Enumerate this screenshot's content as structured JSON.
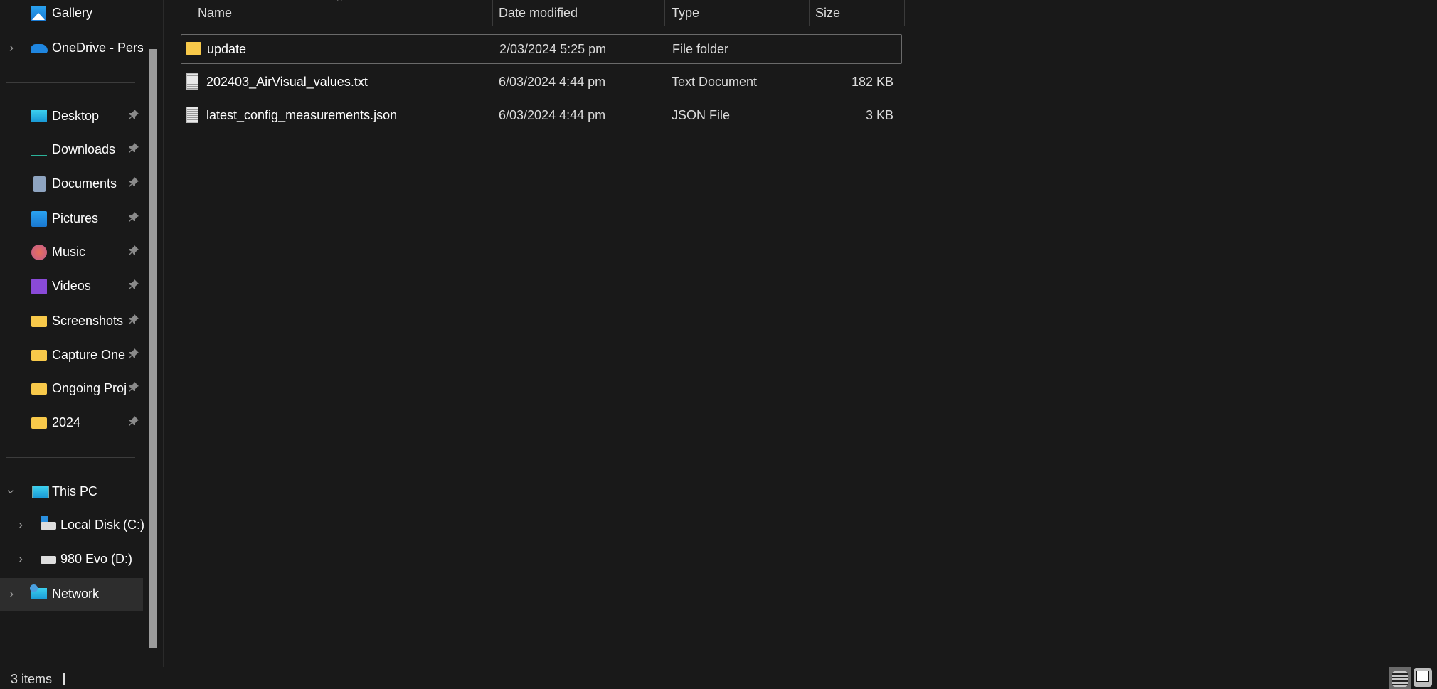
{
  "sidebar": {
    "top_items": [
      {
        "label": "Gallery",
        "icon": "gallery-icon",
        "expandable": false
      },
      {
        "label": "OneDrive - Personal",
        "icon": "onedrive-cloud-icon",
        "expandable": true
      }
    ],
    "quick_access": [
      {
        "label": "Desktop",
        "icon": "desktop-icon",
        "pinned": true
      },
      {
        "label": "Downloads",
        "icon": "download-icon",
        "pinned": true
      },
      {
        "label": "Documents",
        "icon": "documents-icon",
        "pinned": true
      },
      {
        "label": "Pictures",
        "icon": "pictures-icon",
        "pinned": true
      },
      {
        "label": "Music",
        "icon": "music-icon",
        "pinned": true
      },
      {
        "label": "Videos",
        "icon": "videos-icon",
        "pinned": true
      },
      {
        "label": "Screenshots",
        "icon": "folder-icon",
        "pinned": true
      },
      {
        "label": "Capture One",
        "icon": "folder-icon",
        "pinned": true
      },
      {
        "label": "Ongoing Projects",
        "icon": "folder-icon",
        "pinned": true
      },
      {
        "label": "2024",
        "icon": "folder-icon",
        "pinned": true
      }
    ],
    "this_pc": {
      "label": "This PC",
      "icon": "monitor-icon",
      "expanded": true
    },
    "drives": [
      {
        "label": "Local Disk (C:)",
        "icon": "drive-c-icon"
      },
      {
        "label": "980 Evo (D:)",
        "icon": "drive-d-icon"
      }
    ],
    "network": {
      "label": "Network",
      "icon": "network-icon",
      "selected": true
    }
  },
  "file_list": {
    "columns": {
      "name": "Name",
      "date": "Date modified",
      "type": "Type",
      "size": "Size"
    },
    "sort_column": "Name",
    "rows": [
      {
        "name": "update",
        "date": "2/03/2024 5:25 pm",
        "type": "File folder",
        "size": "",
        "icon": "folder-icon",
        "focused": true
      },
      {
        "name": "202403_AirVisual_values.txt",
        "date": "6/03/2024 4:44 pm",
        "type": "Text Document",
        "size": "182 KB",
        "icon": "text-file-icon"
      },
      {
        "name": "latest_config_measurements.json",
        "date": "6/03/2024 4:44 pm",
        "type": "JSON File",
        "size": "3 KB",
        "icon": "text-file-icon"
      }
    ]
  },
  "status_bar": {
    "item_count": "3 items",
    "active_view": "details"
  },
  "colors": {
    "background": "#191919",
    "selected_nav": "#2d2d2d",
    "folder": "#f8c94a",
    "accent": "#0f8fe0"
  }
}
